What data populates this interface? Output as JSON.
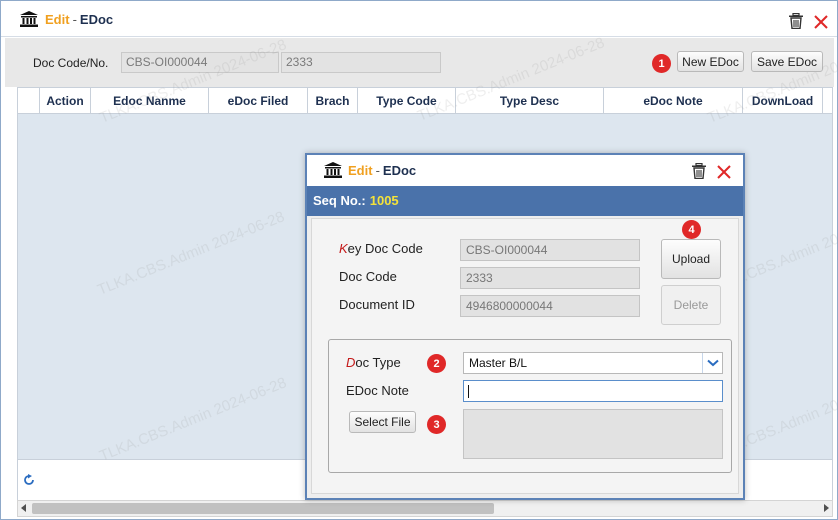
{
  "window": {
    "title_edit": "Edit",
    "title_sep": "-",
    "title_doc": "EDoc"
  },
  "toolbar": {
    "doc_code_label": "Doc Code/No.",
    "doc_code_value": "CBS-OI000044",
    "doc_no_value": "2333",
    "badge_1": "1",
    "new_edoc_label": "New EDoc",
    "save_edoc_label": "Save EDoc"
  },
  "grid": {
    "columns": [
      "Action",
      "Edoc Nanme",
      "eDoc Filed",
      "Brach",
      "Type Code",
      "Type Desc",
      "eDoc Note",
      "DownLoad"
    ]
  },
  "watermark_text": "TLKA.CBS.Admin 2024-06-28",
  "dialog": {
    "title_edit": "Edit",
    "title_sep": "-",
    "title_doc": "EDoc",
    "seq_label": "Seq No.:",
    "seq_value": "1005",
    "key_doc_code_first": "K",
    "key_doc_code_rest": "ey Doc Code",
    "key_doc_code_value": "CBS-OI000044",
    "doc_code_label": "Doc Code",
    "doc_code_value": "2333",
    "document_id_label": "Document ID",
    "document_id_value": "4946800000044",
    "badge_4": "4",
    "upload_label": "Upload",
    "delete_label": "Delete",
    "doc_type_first": "D",
    "doc_type_rest": "oc Type",
    "badge_2": "2",
    "doc_type_value": "Master B/L",
    "edoc_note_label": "EDoc Note",
    "edoc_note_value": "",
    "select_file_label": "Select File",
    "badge_3": "3"
  },
  "colors": {
    "accent": "#4a72aa",
    "title_orange": "#f0a020",
    "seq_yellow": "#f4e23a",
    "badge_red": "#e02828",
    "close_red": "#e02828"
  },
  "icons": [
    "bank-icon",
    "trash-icon",
    "close-icon",
    "chevron-down-icon",
    "refresh-icon"
  ]
}
